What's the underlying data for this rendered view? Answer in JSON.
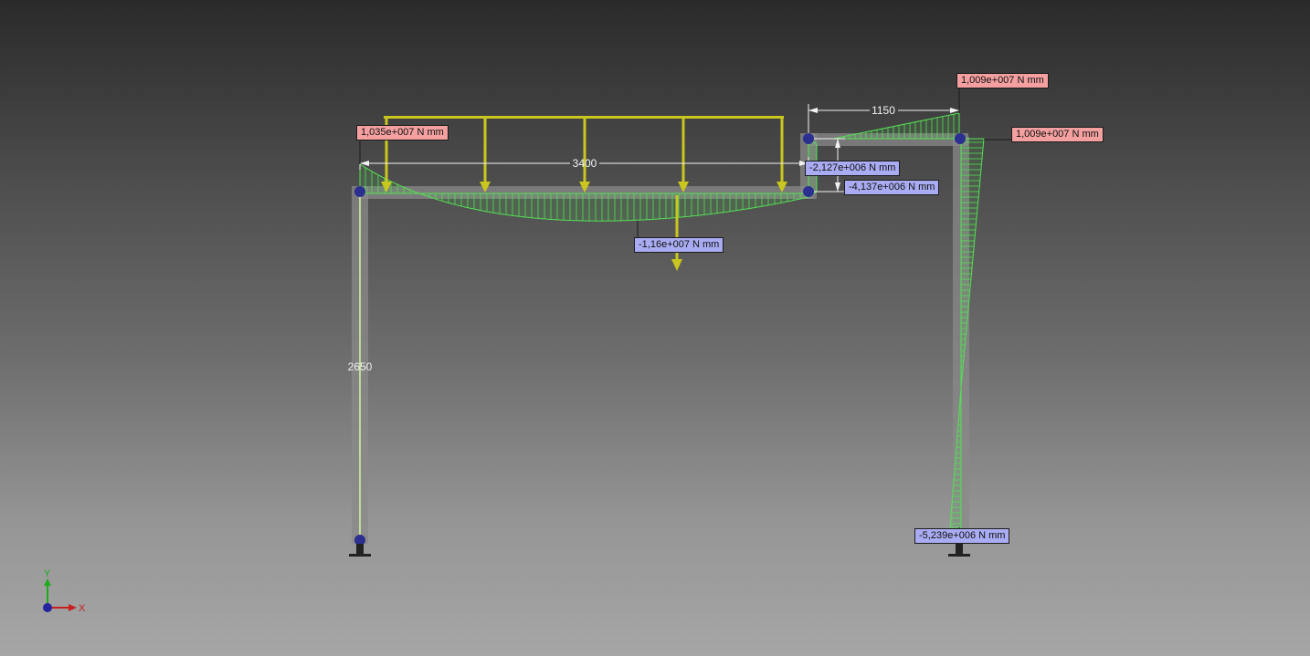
{
  "colors": {
    "frame": "#8a8a8a",
    "load": "#c9c71f",
    "moment": "#55e055",
    "node": "#2b2f8f",
    "positive_label": "#f4a0a0",
    "negative_label": "#a9acf2",
    "dimension": "#f2f2f2"
  },
  "dimensions": {
    "beam_span": "3400",
    "cantilever_span": "1150",
    "column_height": "2650"
  },
  "moment_labels": {
    "left_support": "1,035e+007 N mm",
    "top_right_beam": "1,009e+007 N mm",
    "right_column_top": "1,009e+007 N mm",
    "step_upper": "-2,127e+006 N mm",
    "step_lower": "-4,137e+006 N mm",
    "beam_midspan": "-1,16e+007 N mm",
    "right_column_base": "-5,239e+006 N mm"
  },
  "axes": {
    "x_label": "X",
    "y_label": "Y",
    "x_color": "#c81e1e",
    "y_color": "#1eaa1e",
    "origin_color": "#2424a0"
  },
  "icons": {
    "node": "circle-node-icon",
    "support": "fixed-support-icon",
    "load": "down-arrow-icon"
  }
}
